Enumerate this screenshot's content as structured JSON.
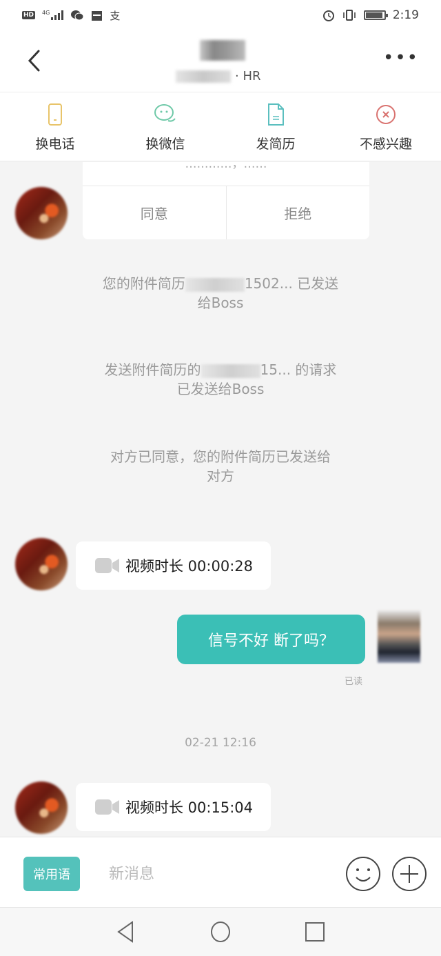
{
  "status_bar": {
    "left_icons": [
      "hd-icon",
      "4g-signal-icon",
      "wechat-icon",
      "calendar-icon",
      "alipay-icon"
    ],
    "network": "4G",
    "right_icons": [
      "alarm-icon",
      "vibrate-icon",
      "battery-icon"
    ],
    "battery_level": 0.9,
    "time": "2:19"
  },
  "header": {
    "back_icon": "chevron-left-icon",
    "title": "",
    "subtitle_suffix": "· HR",
    "more_icon": "more-dots-icon",
    "more_label": "•••"
  },
  "actions": [
    {
      "label": "换电话",
      "icon": "phone-icon",
      "color": "#e8c46a"
    },
    {
      "label": "换微信",
      "icon": "wechat-icon",
      "color": "#6fc9a8"
    },
    {
      "label": "发简历",
      "icon": "document-icon",
      "color": "#5bbfbf"
    },
    {
      "label": "不感兴趣",
      "icon": "close-circle-icon",
      "color": "#d9726f"
    }
  ],
  "messages": {
    "consent_card": {
      "partial_text": "…………，……",
      "agree_label": "同意",
      "reject_label": "拒绝"
    },
    "system_1": {
      "prefix": "您的附件简历",
      "suffix": "1502... 已发送",
      "line2": "给Boss"
    },
    "system_2": {
      "prefix": "发送附件简历的",
      "suffix": "15... 的请求",
      "line2": "已发送给Boss"
    },
    "system_3": {
      "line1": "对方已同意，您的附件简历已发送给",
      "line2": "对方"
    },
    "video_1": {
      "label": "视频时长 00:00:28",
      "icon": "video-camera-icon"
    },
    "outgoing_1": {
      "text": "信号不好 断了吗？",
      "status": "已读"
    },
    "timestamp": "02-21 12:16",
    "video_2": {
      "label": "视频时长 00:15:04",
      "icon": "video-camera-icon"
    }
  },
  "input_bar": {
    "phrases_label": "常用语",
    "placeholder": "新消息",
    "value": "",
    "emoji_icon": "emoji-icon",
    "plus_icon": "plus-circle-icon"
  },
  "colors": {
    "accent": "#3bbfb6",
    "phrases_button": "#54c2bb",
    "background": "#f4f4f4"
  },
  "nav_bar": {
    "back_icon": "nav-back-icon",
    "home_icon": "nav-home-icon",
    "recents_icon": "nav-recents-icon"
  }
}
